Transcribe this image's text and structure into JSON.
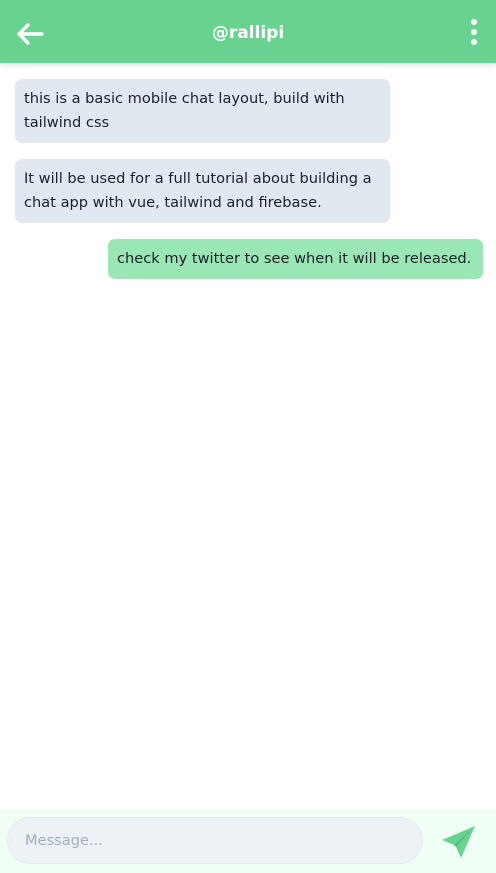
{
  "header": {
    "title": "@rallipi",
    "back_icon": "arrow-left-icon",
    "menu_icon": "more-vertical-icon",
    "background_color": "#68d391"
  },
  "messages": [
    {
      "direction": "received",
      "text": "this is a basic mobile chat layout, build with tailwind css"
    },
    {
      "direction": "received",
      "text": "It will be used for a full tutorial about building a chat app with vue, tailwind and firebase."
    },
    {
      "direction": "sent",
      "text": "check my twitter to see when it will be released."
    }
  ],
  "composer": {
    "placeholder": "Message...",
    "value": "",
    "send_icon": "send-icon"
  },
  "colors": {
    "received_bubble": "#e2e8f0",
    "sent_bubble": "#9ae6b4",
    "footer_background": "#f0fff4",
    "accent": "#68d391"
  }
}
